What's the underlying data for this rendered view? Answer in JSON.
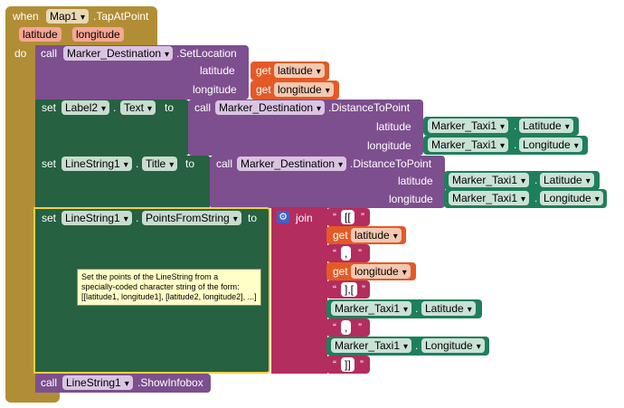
{
  "event": {
    "when": "when",
    "component": "Map1",
    "event_name": ".TapAtPoint",
    "params": [
      "latitude",
      "longitude"
    ],
    "do": "do"
  },
  "call1": {
    "call": "call",
    "component": "Marker_Destination",
    "method": ".SetLocation",
    "args": [
      {
        "label": "latitude",
        "get": "get",
        "var": "latitude"
      },
      {
        "label": "longitude",
        "get": "get",
        "var": "longitude"
      }
    ]
  },
  "set1": {
    "set": "set",
    "component": "Label2",
    "property": "Text",
    "to": "to",
    "call": "call",
    "call_component": "Marker_Destination",
    "method": ".DistanceToPoint",
    "args": [
      {
        "label": "latitude",
        "component": "Marker_Taxi1",
        "dot": ".",
        "property": "Latitude"
      },
      {
        "label": "longitude",
        "component": "Marker_Taxi1",
        "dot": ".",
        "property": "Longitude"
      }
    ]
  },
  "set2": {
    "set": "set",
    "component": "LineString1",
    "property": "Title",
    "to": "to",
    "call": "call",
    "call_component": "Marker_Destination",
    "method": ".DistanceToPoint",
    "args": [
      {
        "label": "latitude",
        "component": "Marker_Taxi1",
        "dot": ".",
        "property": "Latitude"
      },
      {
        "label": "longitude",
        "component": "Marker_Taxi1",
        "dot": ".",
        "property": "Longitude"
      }
    ]
  },
  "set3": {
    "set": "set",
    "component": "LineString1",
    "property": "PointsFromString",
    "to": "to",
    "join": "join",
    "comment": "Set the points of the LineString from a\nspecially-coded character string of the form:\n[[latitude1, longitude1], [latitude2, longitude2], ...]",
    "items": {
      "s1": "[[",
      "get": "get",
      "var_lat": "latitude",
      "s2": ",",
      "var_lon": "longitude",
      "s3": "],[",
      "comp": "Marker_Taxi1",
      "dot": ".",
      "prop_lat": "Latitude",
      "s4": ",",
      "prop_lon": "Longitude",
      "s5": "]]"
    }
  },
  "call2": {
    "call": "call",
    "component": "LineString1",
    "method": ".ShowInfobox"
  },
  "colors": {
    "event": "#B18E35",
    "procedure": "#7D4F8E",
    "setter": "#266141",
    "component": "#1F7F5C",
    "variable": "#E35A26",
    "text": "#B32D5E",
    "comment": "#FFFFC7"
  },
  "icons": {
    "mutator": "gear-icon",
    "dropdown": "chevron-down-icon"
  }
}
